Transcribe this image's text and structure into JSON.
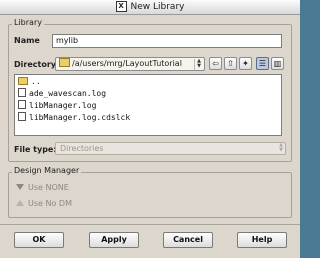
{
  "window": {
    "title": "New Library"
  },
  "library": {
    "group_label": "Library",
    "name_label": "Name",
    "name_value": "mylib",
    "directory_label": "Directory",
    "directory_value": "/a/users/mrg/LayoutTutorial",
    "files": [
      {
        "name": "..",
        "kind": "folder"
      },
      {
        "name": "ade_wavescan.log",
        "kind": "file"
      },
      {
        "name": "libManager.log",
        "kind": "file"
      },
      {
        "name": "libManager.log.cdslck",
        "kind": "file"
      }
    ],
    "filetype_label": "File type:",
    "filetype_value": "Directories"
  },
  "toolbar": {
    "back_icon": "back-arrow-icon",
    "up_icon": "up-folder-icon",
    "new_folder_icon": "new-folder-icon",
    "list_view_icon": "list-view-icon",
    "detail_view_icon": "detail-view-icon"
  },
  "design_manager": {
    "group_label": "Design Manager",
    "options": [
      {
        "label": "Use NONE",
        "selected": true
      },
      {
        "label": "Use No DM",
        "selected": false
      }
    ]
  },
  "buttons": {
    "ok": "OK",
    "apply": "Apply",
    "cancel": "Cancel",
    "help": "Help"
  }
}
